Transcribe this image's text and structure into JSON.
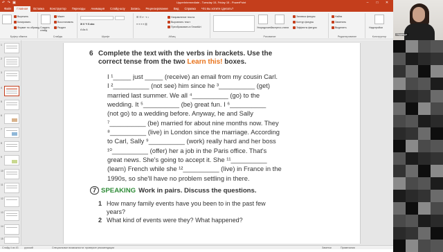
{
  "titlebar": {
    "title": "UpperIntermediate - Tuesday 15, Friday 15 - PowerPoint",
    "quick_access": "↶ ↷ ▣"
  },
  "ribbon_tabs": [
    "Файл",
    "Главная",
    "Вставка",
    "Конструктор",
    "Переходы",
    "Анимация",
    "Слайд-шоу",
    "Запись",
    "Рецензирование",
    "Вид",
    "Справка",
    "Что вы хотите сделать?"
  ],
  "ribbon": {
    "clipboard": {
      "cut": "Вырезать",
      "copy": "Копировать",
      "format": "Формат по образцу",
      "label": "Буфер обмена"
    },
    "slides": {
      "new_slide": "Создать слайд",
      "layout": "Макет",
      "reset": "Восстановить",
      "section": "Раздел",
      "label": "Слайды"
    },
    "font": {
      "label": "Шрифт"
    },
    "paragraph": {
      "label": "Абзац",
      "text_direction": "Направление текста",
      "align_text": "Выровнять текст",
      "smartart": "Преобразовать в SmartArt"
    },
    "drawing": {
      "arrange": "Упорядочить",
      "quick_styles": "Экспресс-стили",
      "label": "Рисование",
      "fill": "Заливка фигуры",
      "outline": "Контур фигуры",
      "effects": "Эффекты фигуры"
    },
    "editing": {
      "find": "Найти",
      "replace": "Заменить",
      "select": "Выделить",
      "label": "Редактирование"
    },
    "designer": {
      "label": "Конструктор",
      "ideas": "Надстройки"
    }
  },
  "slide": {
    "q6_num": "6",
    "q6_line1": "Complete the text with the verbs in brackets. Use the",
    "q6_line2_a": "correct tense from the two ",
    "q6_learn": "Learn this!",
    "q6_line2_b": " boxes.",
    "para_lines": [
      "I ¹_____ just _____ (receive) an email from my cousin Carl.",
      "I ²__________ (not see) him since he ³__________ (get)",
      "married last summer. We all ⁴__________ (go) to the",
      "wedding. It ⁵__________ (be) great fun. I ⁶__________",
      "(not go) to a wedding before. Anyway, he and Sally",
      "⁷__________ (be) married for about nine months now. They",
      "⁸__________ (live) in London since the marriage. According",
      "to Carl, Sally ⁹__________ (work) really hard and her boss",
      "¹⁰__________ (offer) her a job in the Paris office. That's",
      "great news. She's going to accept it. She ¹¹__________",
      "(learn) French while she ¹²__________ (live) in France in the",
      "1990s, so she'll have no problem settling in there."
    ],
    "q7_num": "7",
    "q7_speaking": "SPEAKING",
    "q7_instr": "Work in pairs. Discuss the questions.",
    "questions": [
      {
        "n": "1",
        "text": "How many family events have you been to in the past few years?"
      },
      {
        "n": "2",
        "text": "What kind of events were they? What happened?"
      }
    ]
  },
  "thumbnails": [
    "1",
    "2",
    "3",
    "4",
    "5",
    "6",
    "7",
    "8",
    "9",
    "10",
    "11",
    "12",
    "13",
    "14",
    "15"
  ],
  "status": {
    "slide_pos": "Слайд 4 из 43",
    "lang": "русский",
    "accessibility": "Специальные возможности: проверьте рекомендации",
    "notes": "Заметки",
    "comments": "Примечания"
  },
  "video": {
    "name": "Надежда"
  },
  "colors": {
    "accent": "#c43e1c",
    "learn_this": "#e8731b",
    "speaking": "#2e8b36"
  }
}
